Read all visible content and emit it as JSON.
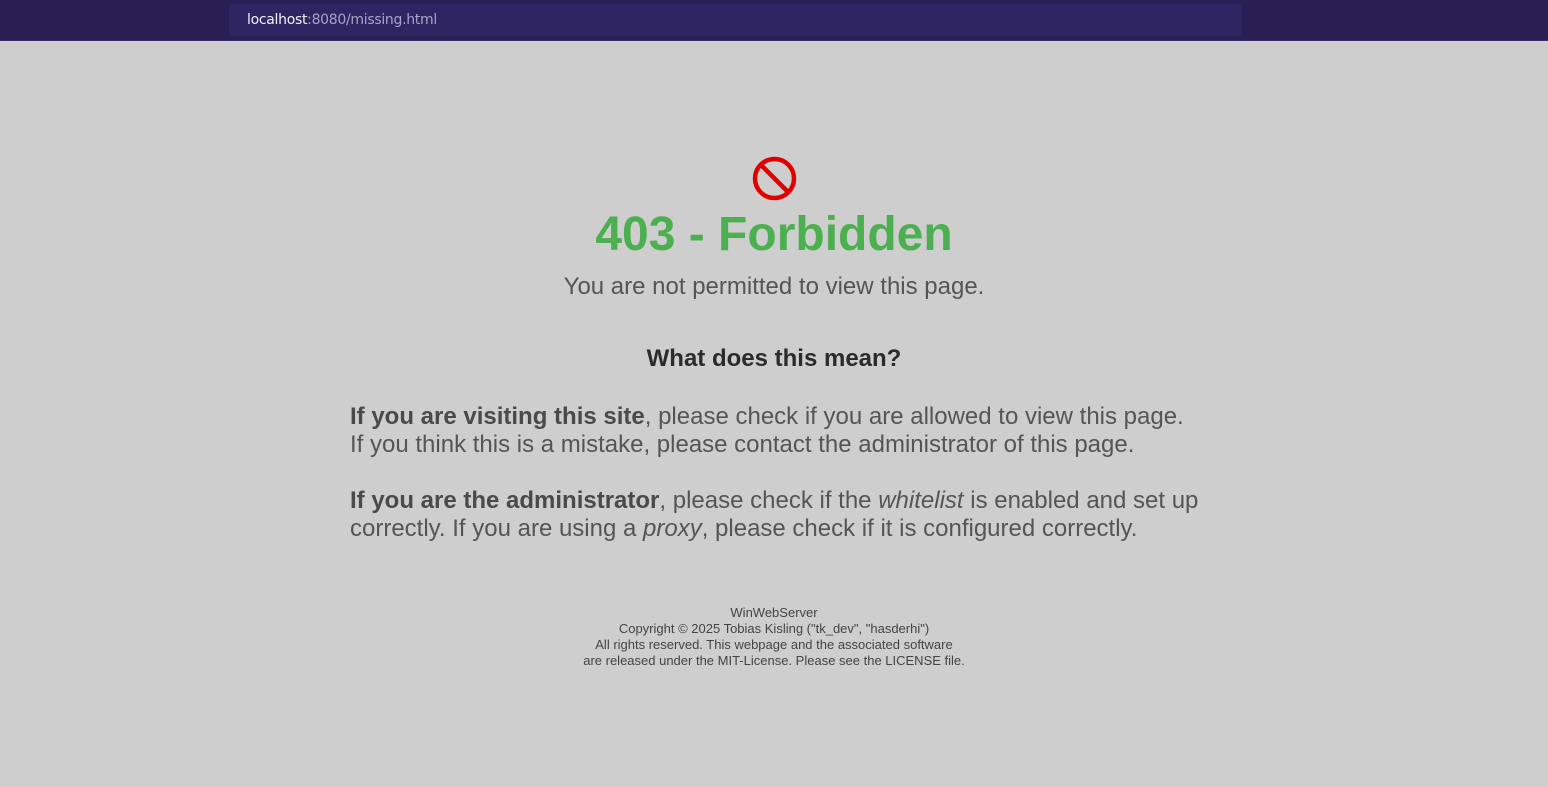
{
  "browser": {
    "address_host": "localhost",
    "address_rest": ":8080/missing.html"
  },
  "icon": "forbidden-icon",
  "colors": {
    "title": "#4caf50",
    "icon": "#e00000",
    "background": "#cecece"
  },
  "page": {
    "title": "403 - Forbidden",
    "subtitle": "You are not permitted to view this page.",
    "heading": "What does this mean?",
    "visitor": {
      "bold": "If you are visiting this site",
      "text1": ", please check if you are allowed to view this page.",
      "text2": "If you think this is a mistake, please contact the administrator of this page."
    },
    "admin": {
      "bold": "If you are the administrator",
      "text1": ", please check if the ",
      "italic1": "whitelist",
      "text2": " is enabled and set up correctly. If you are using a ",
      "italic2": "proxy",
      "text3": ", please check if it is configured correctly."
    }
  },
  "footer": {
    "line1": "WinWebServer",
    "line2": "Copyright © 2025 Tobias Kisling (\"tk_dev\", \"hasderhi\")",
    "line3": "All rights reserved. This webpage and the associated software",
    "line4": "are released under the MIT-License. Please see the LICENSE file."
  }
}
